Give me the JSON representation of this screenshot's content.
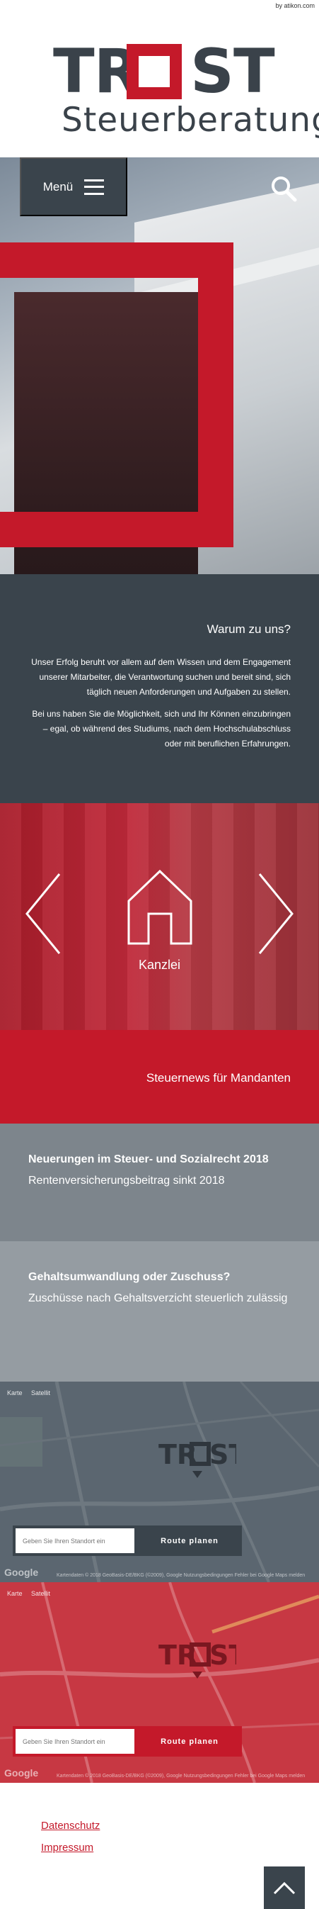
{
  "credit": "by atikon.com",
  "logo": {
    "left": "TR",
    "right": "ST",
    "subtitle": "Steuerberatung"
  },
  "header": {
    "menu_label": "Menü"
  },
  "why": {
    "title": "Warum zu uns?",
    "p1": "Unser Erfolg beruht vor allem auf dem Wissen und dem Engagement unserer Mitarbeiter, die Verantwortung suchen und bereit sind, sich täglich neuen Anforderungen und Aufgaben zu stellen.",
    "p2": "Bei uns haben Sie die Möglichkeit, sich und Ihr Können einzubringen – egal, ob während des Studiums, nach dem Hochschulabschluss oder mit beruflichen Erfahrungen."
  },
  "kanzlei": {
    "label": "Kanzlei"
  },
  "news": {
    "banner": "Steuernews für Mandanten",
    "items": [
      {
        "title": "Neuerungen im Steuer- und Sozialrecht 2018",
        "text": "Rentenversicherungsbeitrag sinkt 2018"
      },
      {
        "title": "Gehaltsumwandlung oder Zuschuss?",
        "text": "Zuschüsse nach Gehaltsverzicht steuerlich zulässig"
      }
    ]
  },
  "map": {
    "tab_map": "Karte",
    "tab_sat": "Satellit",
    "input_placeholder": "Geben Sie Ihren Standort ein",
    "button": "Route planen",
    "google": "Google",
    "copyright": "Kartendaten © 2018 GeoBasis-DE/BKG (©2009), Google  Nutzungsbedingungen  Fehler bei Google Maps melden"
  },
  "footer": {
    "privacy": "Datenschutz",
    "imprint": "Impressum"
  },
  "colors": {
    "brand_red": "#c4192a",
    "dark": "#3a444c"
  }
}
